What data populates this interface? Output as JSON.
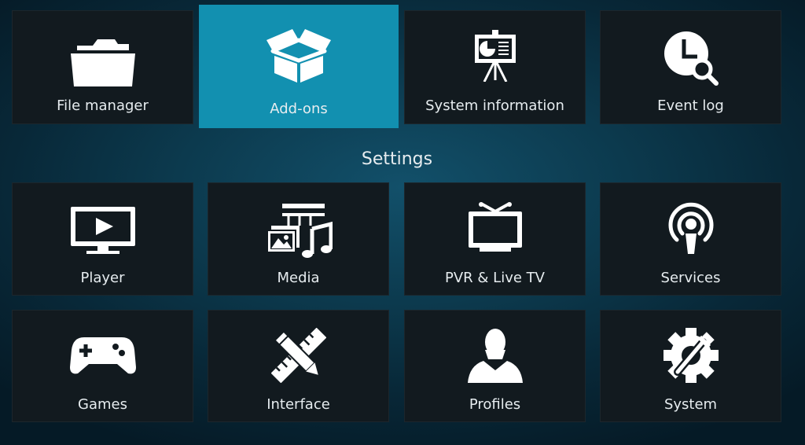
{
  "top_row": [
    {
      "label": "File manager",
      "icon": "folder-icon"
    },
    {
      "label": "Add-ons",
      "icon": "box-icon",
      "focused": true
    },
    {
      "label": "System information",
      "icon": "presentation-board-icon"
    },
    {
      "label": "Event log",
      "icon": "clock-search-icon"
    }
  ],
  "settings": {
    "title": "Settings",
    "items": [
      {
        "label": "Player",
        "icon": "monitor-play-icon"
      },
      {
        "label": "Media",
        "icon": "media-library-icon"
      },
      {
        "label": "PVR & Live TV",
        "icon": "tv-antenna-icon"
      },
      {
        "label": "Services",
        "icon": "podcast-icon"
      },
      {
        "label": "Games",
        "icon": "gamepad-icon"
      },
      {
        "label": "Interface",
        "icon": "pencil-ruler-icon"
      },
      {
        "label": "Profiles",
        "icon": "person-icon"
      },
      {
        "label": "System",
        "icon": "gear-tools-icon"
      }
    ]
  },
  "colors": {
    "focus": "#1290b0",
    "tile": "#121a1f",
    "text": "#e6ecef"
  }
}
